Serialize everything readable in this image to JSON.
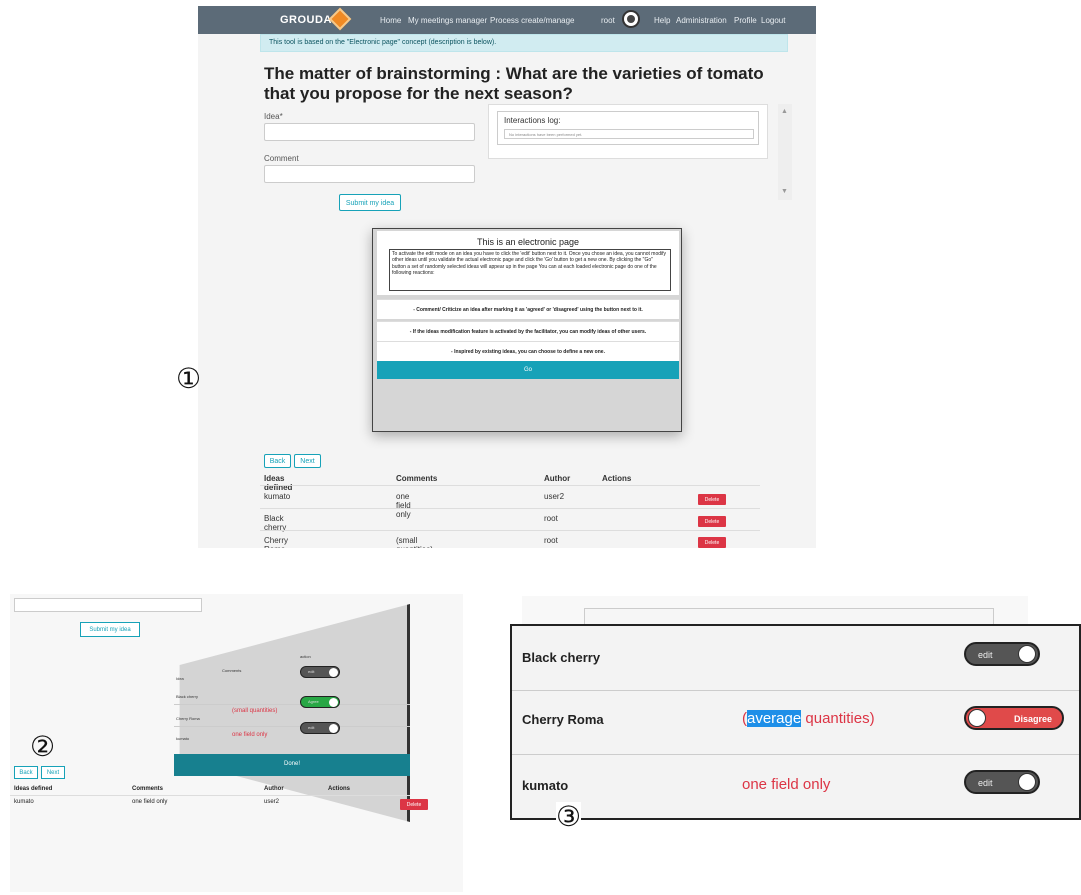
{
  "panel1": {
    "nav": {
      "brand": "GROUDA",
      "links": [
        "Home",
        "My meetings manager",
        "Process create/manage"
      ],
      "user": "root",
      "right_links": [
        "Help",
        "Administration",
        "Profile",
        "Logout"
      ]
    },
    "info_banner": "This tool is based on the \"Electronic page\" concept (description is below).",
    "title": "The matter of brainstorming : What are the varieties of tomato that you propose for the next season?",
    "idea_label": "Idea*",
    "comment_label": "Comment",
    "submit_label": "Submit my idea",
    "log": {
      "title": "Interactions log:",
      "placeholder": "No interactions have been performed yet."
    },
    "modal": {
      "title": "This is an electronic page",
      "text": "To activate the edit mode on an idea you have to click the 'edit' button next to it. Once you chose an idea, you cannot modify other ideas until you validate the actual electronic page and click the 'Go' button to get a new one. By clicking the \"Go\" button a set of randomly selected ideas will appear up in the page You can at each loaded electronic page do one of the following reactions:",
      "rows": [
        "- Comment/ Criticize an idea after marking it as 'agreed' or 'disagreed' using the button next to it.",
        "- If the ideas modification feature is activated by the facilitator, you can modify ideas of other users.",
        "- Inspired by existing ideas, you can choose to define a new one."
      ],
      "go": "Go"
    },
    "pager": {
      "back": "Back",
      "next": "Next"
    },
    "table": {
      "headers": [
        "Ideas defined",
        "Comments",
        "Author",
        "Actions"
      ],
      "rows": [
        {
          "idea": "kumato",
          "comment": "one field only",
          "author": "user2",
          "action": "Delete"
        },
        {
          "idea": "Black cherry",
          "comment": "",
          "author": "root",
          "action": "Delete"
        },
        {
          "idea": "Cherry Roma",
          "comment": "(small quantities)",
          "author": "root",
          "action": "Delete"
        }
      ]
    },
    "marker": "①"
  },
  "panel2": {
    "submit_label": "Submit my idea",
    "skewed": {
      "headers": [
        "Idea",
        "Comments",
        "action"
      ],
      "rows": [
        {
          "idea": "Black cherry",
          "comment": "",
          "toggle": "edit"
        },
        {
          "idea": "Cherry Roma",
          "comment": "(small quantities)",
          "toggle": "Agree"
        },
        {
          "idea": "kumato",
          "comment": "one field only",
          "toggle": "edit"
        }
      ],
      "done": "Done!"
    },
    "pager": {
      "back": "Back",
      "next": "Next"
    },
    "table": {
      "headers": [
        "Ideas defined",
        "Comments",
        "Author",
        "Actions"
      ],
      "row": {
        "idea": "kumato",
        "comment": "one field only",
        "author": "user2",
        "action": "Delete"
      }
    },
    "marker": "②"
  },
  "panel3": {
    "rows": [
      {
        "idea": "Black cherry",
        "comment": "",
        "toggle": "edit"
      },
      {
        "idea": "Cherry Roma",
        "comment_selected": "average",
        "comment_rest": " quantities)",
        "comment_prefix": "(",
        "toggle": "Disagree"
      },
      {
        "idea": "kumato",
        "comment": "one field only",
        "toggle": "edit"
      }
    ],
    "marker": "③"
  }
}
